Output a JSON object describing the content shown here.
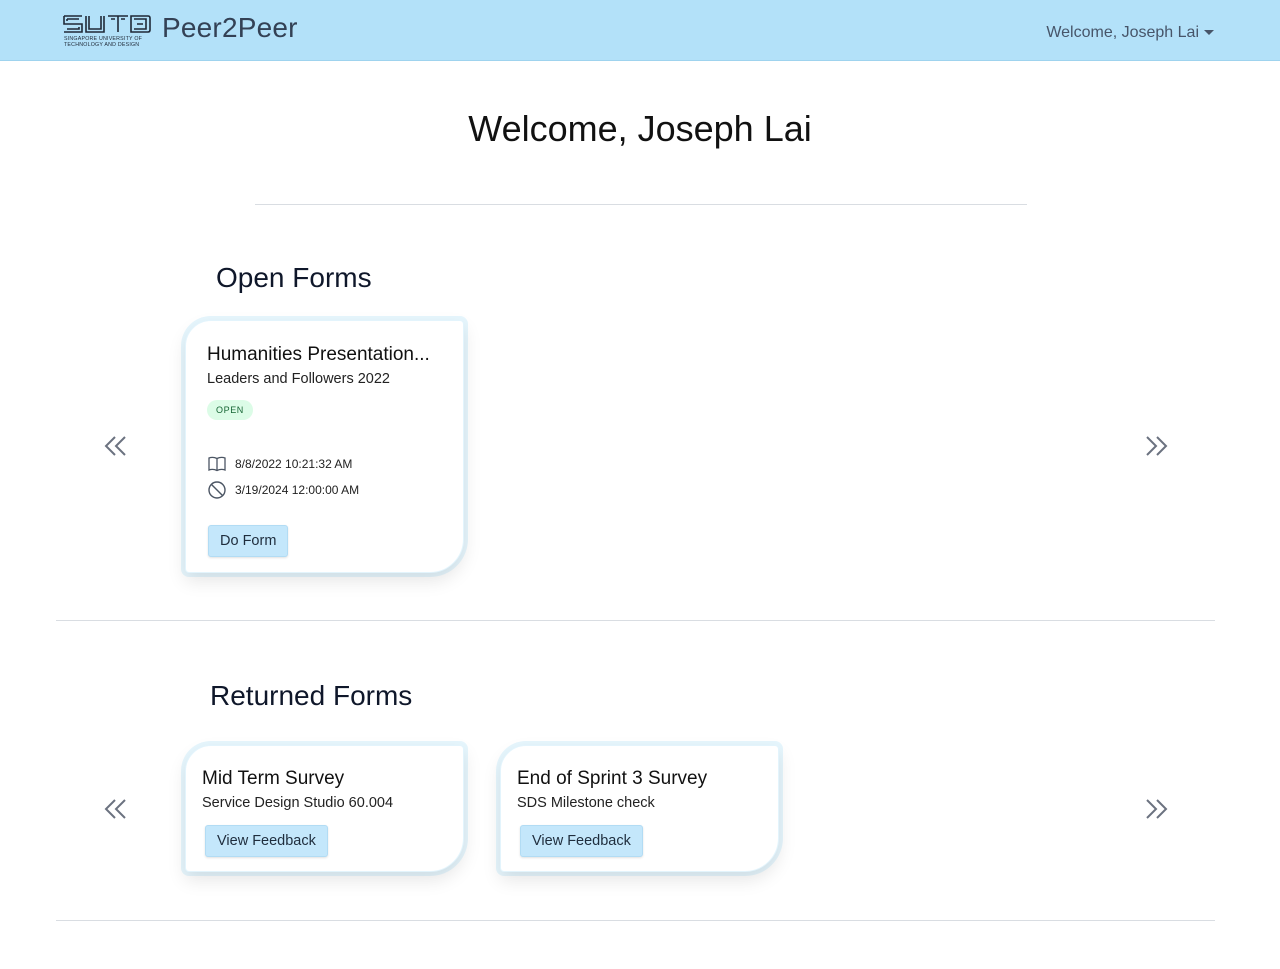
{
  "navbar": {
    "logo_subtext_line1": "SINGAPORE UNIVERSITY OF",
    "logo_subtext_line2": "TECHNOLOGY AND DESIGN",
    "brand": "Peer2Peer",
    "user_menu_label": "Welcome, Joseph Lai"
  },
  "page_title": "Welcome, Joseph Lai",
  "open_forms": {
    "heading": "Open Forms",
    "cards": [
      {
        "title": "Humanities Presentation...",
        "subtitle": "Leaders and Followers 2022",
        "status": "OPEN",
        "created": "8/8/2022 10:21:32 AM",
        "due": "3/19/2024 12:00:00 AM",
        "action_label": "Do Form"
      }
    ]
  },
  "returned_forms": {
    "heading": "Returned Forms",
    "cards": [
      {
        "title": "Mid Term Survey",
        "subtitle": "Service Design Studio 60.004",
        "action_label": "View Feedback"
      },
      {
        "title": "End of Sprint 3 Survey",
        "subtitle": "SDS Milestone check",
        "action_label": "View Feedback"
      }
    ]
  },
  "colors": {
    "navbar_bg": "#b3e1f9",
    "button_bg": "#c4e7fb",
    "badge_bg": "#dcfce7"
  }
}
